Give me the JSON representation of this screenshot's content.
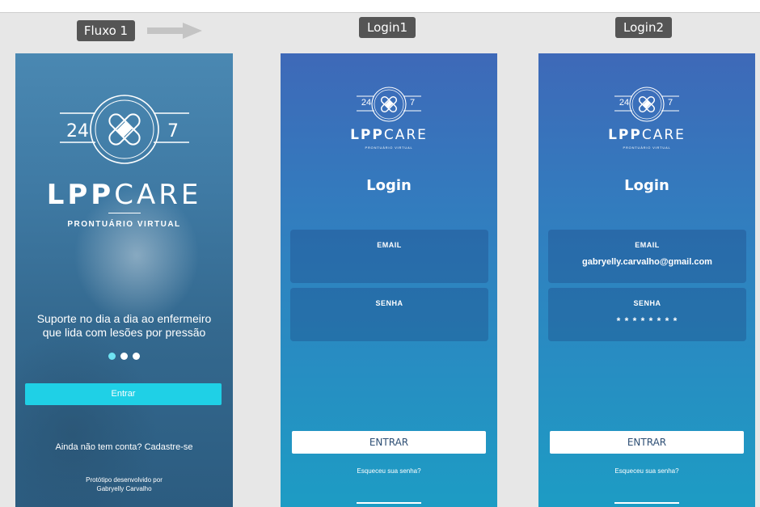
{
  "flow": {
    "tags": {
      "fluxo": "Fluxo 1",
      "login1": "Login1",
      "login2": "Login2"
    }
  },
  "logo": {
    "num_left": "24",
    "num_right": "7",
    "brand_pp": "LPP",
    "brand_care": "CARE",
    "tagline": "PRONTUÁRIO VIRTUAL"
  },
  "welcome": {
    "subtitle_line1": "Suporte no dia a dia ao enfermeiro",
    "subtitle_line2": "que lida com lesões por pressão",
    "carousel": {
      "count": 3,
      "active": 1
    },
    "enter_button": "Entrar",
    "signup_text": "Ainda não tem conta? Cadastre-se",
    "credit_line1": "Protótipo desenvolvido por",
    "credit_line2": "Gabryelly Carvalho"
  },
  "login1": {
    "heading": "Login",
    "email_label": "EMAIL",
    "email_value": "",
    "password_label": "SENHA",
    "password_value": "",
    "submit": "ENTRAR",
    "forgot": "Esqueceu sua senha?"
  },
  "login2": {
    "heading": "Login",
    "email_label": "EMAIL",
    "email_value": "gabryelly.carvalho@gmail.com",
    "password_label": "SENHA",
    "password_value": "* * * * * * * *",
    "submit": "ENTRAR",
    "forgot": "Esqueceu sua senha?"
  },
  "colors": {
    "canvas": "#e7e7e7",
    "tag": "#555555",
    "accent_button": "#1fd0e6",
    "login_top": "#3e69b8",
    "login_bottom": "#1d9cc4"
  }
}
